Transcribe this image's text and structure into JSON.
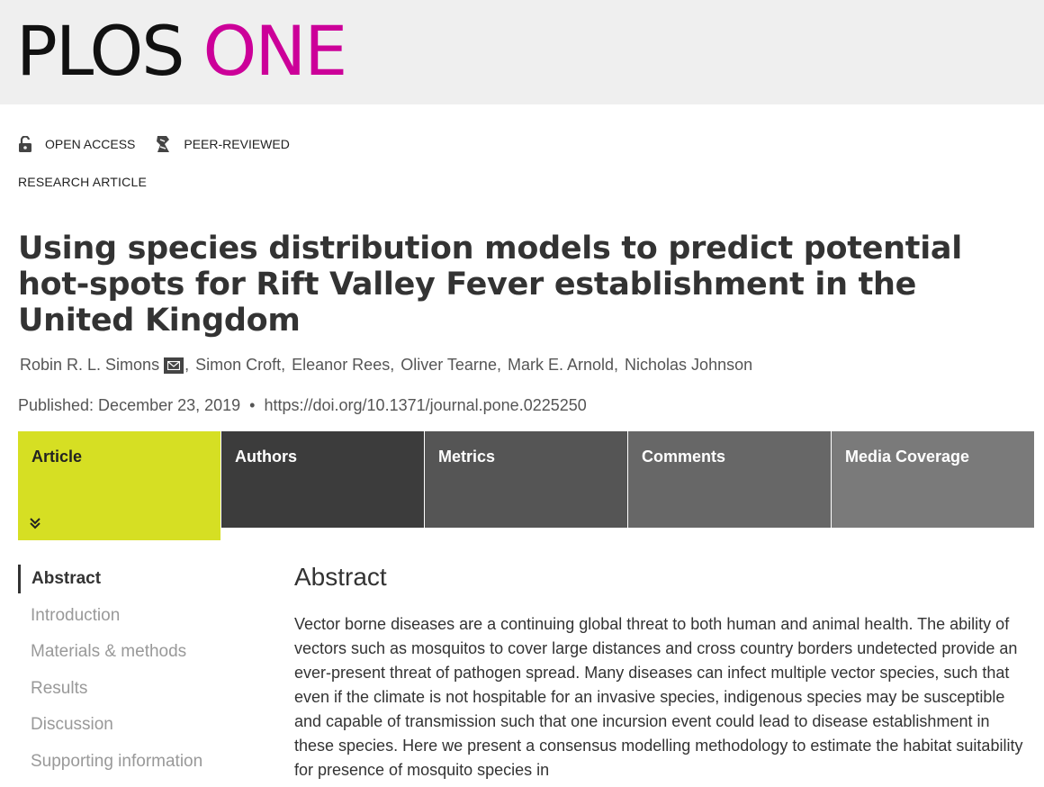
{
  "journal": {
    "name_part1": "PLOS",
    "name_part2": "ONE",
    "brand_color": "#cc0099"
  },
  "badges": [
    {
      "icon": "open-lock-icon",
      "label": "OPEN ACCESS"
    },
    {
      "icon": "peer-reviewed-icon",
      "label": "PEER-REVIEWED"
    }
  ],
  "article_type": "RESEARCH ARTICLE",
  "title": "Using species distribution models to predict potential hot-spots for Rift Valley Fever establishment in the United Kingdom",
  "authors": [
    {
      "name": "Robin R. L. Simons",
      "separator": ",",
      "has_email": true
    },
    {
      "name": "Simon Croft",
      "separator": ","
    },
    {
      "name": "Eleanor Rees",
      "separator": ","
    },
    {
      "name": "Oliver Tearne",
      "separator": ","
    },
    {
      "name": "Mark E. Arnold",
      "separator": ","
    },
    {
      "name": "Nicholas Johnson",
      "separator": ""
    }
  ],
  "published": {
    "label": "Published: December 23, 2019",
    "bullet": "•",
    "doi": "https://doi.org/10.1371/journal.pone.0225250"
  },
  "tabs": [
    {
      "label": "Article",
      "active": true,
      "accent": "#d6df23"
    },
    {
      "label": "Authors"
    },
    {
      "label": "Metrics"
    },
    {
      "label": "Comments"
    },
    {
      "label": "Media Coverage"
    }
  ],
  "toc": [
    {
      "label": "Abstract",
      "active": true
    },
    {
      "label": "Introduction"
    },
    {
      "label": "Materials & methods"
    },
    {
      "label": "Results"
    },
    {
      "label": "Discussion"
    },
    {
      "label": "Supporting information"
    }
  ],
  "abstract": {
    "heading": "Abstract",
    "text": "Vector borne diseases are a continuing global threat to both human and animal health. The ability of vectors such as mosquitos to cover large distances and cross country borders undetected provide an ever-present threat of pathogen spread. Many diseases can infect multiple vector species, such that even if the climate is not hospitable for an invasive species, indigenous species may be susceptible and capable of transmission such that one incursion event could lead to disease establishment in these species. Here we present a consensus modelling methodology to estimate the habitat suitability for presence of mosquito species in"
  }
}
